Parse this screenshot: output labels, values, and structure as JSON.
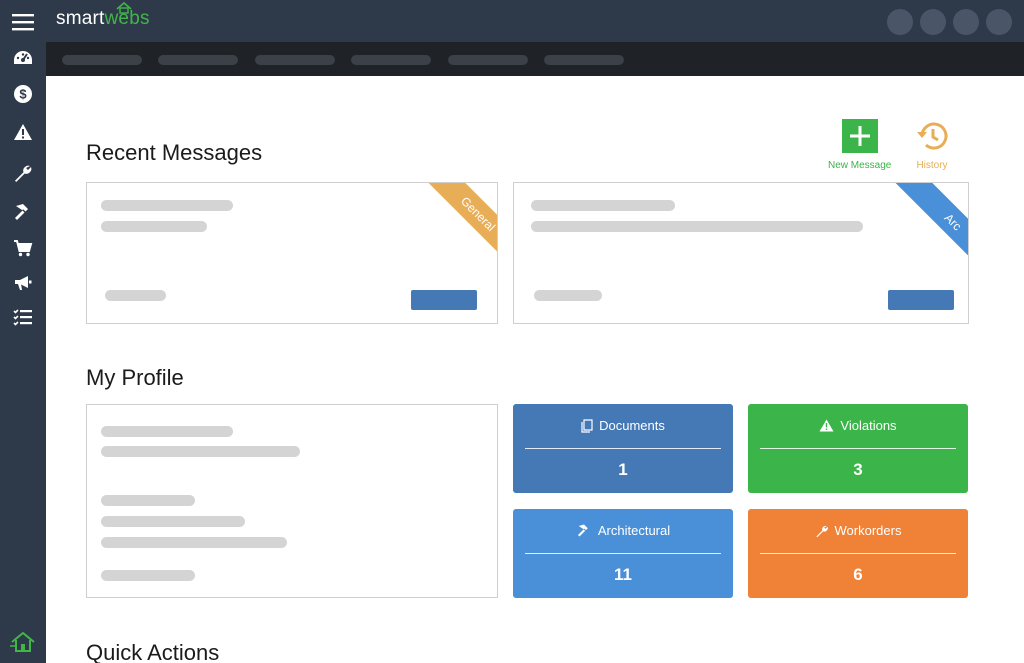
{
  "app": {
    "logo_part1": "smart",
    "logo_part2": "webs"
  },
  "sidebar": {
    "icons": [
      "menu-icon",
      "dashboard-icon",
      "dollar-icon",
      "warning-icon",
      "wrench-icon",
      "hammer-icon",
      "cart-icon",
      "megaphone-icon",
      "checklist-icon",
      "home-icon"
    ]
  },
  "recent_messages": {
    "title": "Recent Messages",
    "new_message_label": "New Message",
    "history_label": "History",
    "cards": [
      {
        "tag": "General",
        "tag_color": "#e8ae57"
      },
      {
        "tag": "Arc",
        "tag_color": "#4a90d9"
      }
    ]
  },
  "profile": {
    "title": "My Profile",
    "tiles": [
      {
        "label": "Documents",
        "value": "1",
        "color": "#4579b5",
        "icon": "document-icon"
      },
      {
        "label": "Violations",
        "value": "3",
        "color": "#3bb54a",
        "icon": "warning-icon"
      },
      {
        "label": "Architectural",
        "value": "11",
        "color": "#4a90d9",
        "icon": "hammer-icon"
      },
      {
        "label": "Workorders",
        "value": "6",
        "color": "#ef8236",
        "icon": "wrench-icon"
      }
    ]
  },
  "quick_actions": {
    "title": "Quick Actions"
  },
  "colors": {
    "sidebar": "#2e3a4a",
    "subnav": "#1f2226",
    "accent_green": "#3bb54a",
    "accent_orange": "#e8ae57"
  }
}
